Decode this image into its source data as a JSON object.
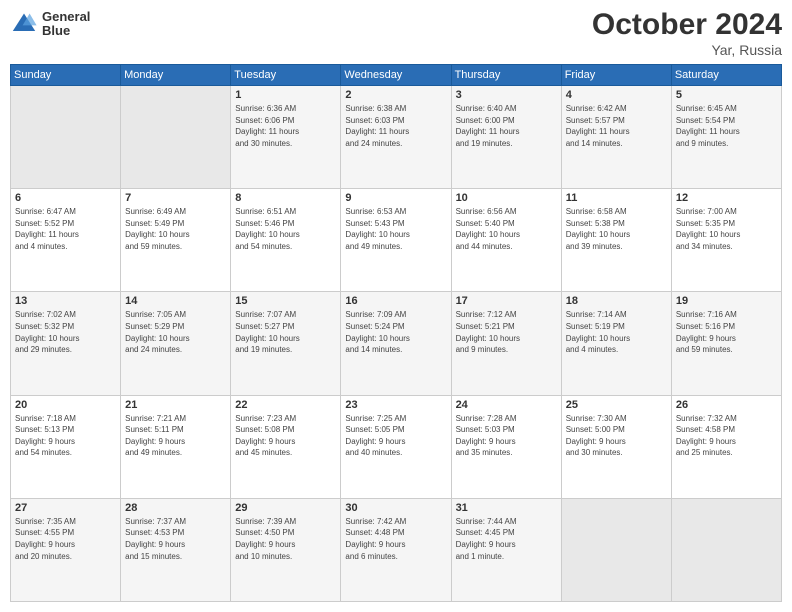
{
  "header": {
    "logo_line1": "General",
    "logo_line2": "Blue",
    "month": "October 2024",
    "location": "Yar, Russia"
  },
  "days_of_week": [
    "Sunday",
    "Monday",
    "Tuesday",
    "Wednesday",
    "Thursday",
    "Friday",
    "Saturday"
  ],
  "weeks": [
    [
      {
        "day": "",
        "info": ""
      },
      {
        "day": "",
        "info": ""
      },
      {
        "day": "1",
        "info": "Sunrise: 6:36 AM\nSunset: 6:06 PM\nDaylight: 11 hours\nand 30 minutes."
      },
      {
        "day": "2",
        "info": "Sunrise: 6:38 AM\nSunset: 6:03 PM\nDaylight: 11 hours\nand 24 minutes."
      },
      {
        "day": "3",
        "info": "Sunrise: 6:40 AM\nSunset: 6:00 PM\nDaylight: 11 hours\nand 19 minutes."
      },
      {
        "day": "4",
        "info": "Sunrise: 6:42 AM\nSunset: 5:57 PM\nDaylight: 11 hours\nand 14 minutes."
      },
      {
        "day": "5",
        "info": "Sunrise: 6:45 AM\nSunset: 5:54 PM\nDaylight: 11 hours\nand 9 minutes."
      }
    ],
    [
      {
        "day": "6",
        "info": "Sunrise: 6:47 AM\nSunset: 5:52 PM\nDaylight: 11 hours\nand 4 minutes."
      },
      {
        "day": "7",
        "info": "Sunrise: 6:49 AM\nSunset: 5:49 PM\nDaylight: 10 hours\nand 59 minutes."
      },
      {
        "day": "8",
        "info": "Sunrise: 6:51 AM\nSunset: 5:46 PM\nDaylight: 10 hours\nand 54 minutes."
      },
      {
        "day": "9",
        "info": "Sunrise: 6:53 AM\nSunset: 5:43 PM\nDaylight: 10 hours\nand 49 minutes."
      },
      {
        "day": "10",
        "info": "Sunrise: 6:56 AM\nSunset: 5:40 PM\nDaylight: 10 hours\nand 44 minutes."
      },
      {
        "day": "11",
        "info": "Sunrise: 6:58 AM\nSunset: 5:38 PM\nDaylight: 10 hours\nand 39 minutes."
      },
      {
        "day": "12",
        "info": "Sunrise: 7:00 AM\nSunset: 5:35 PM\nDaylight: 10 hours\nand 34 minutes."
      }
    ],
    [
      {
        "day": "13",
        "info": "Sunrise: 7:02 AM\nSunset: 5:32 PM\nDaylight: 10 hours\nand 29 minutes."
      },
      {
        "day": "14",
        "info": "Sunrise: 7:05 AM\nSunset: 5:29 PM\nDaylight: 10 hours\nand 24 minutes."
      },
      {
        "day": "15",
        "info": "Sunrise: 7:07 AM\nSunset: 5:27 PM\nDaylight: 10 hours\nand 19 minutes."
      },
      {
        "day": "16",
        "info": "Sunrise: 7:09 AM\nSunset: 5:24 PM\nDaylight: 10 hours\nand 14 minutes."
      },
      {
        "day": "17",
        "info": "Sunrise: 7:12 AM\nSunset: 5:21 PM\nDaylight: 10 hours\nand 9 minutes."
      },
      {
        "day": "18",
        "info": "Sunrise: 7:14 AM\nSunset: 5:19 PM\nDaylight: 10 hours\nand 4 minutes."
      },
      {
        "day": "19",
        "info": "Sunrise: 7:16 AM\nSunset: 5:16 PM\nDaylight: 9 hours\nand 59 minutes."
      }
    ],
    [
      {
        "day": "20",
        "info": "Sunrise: 7:18 AM\nSunset: 5:13 PM\nDaylight: 9 hours\nand 54 minutes."
      },
      {
        "day": "21",
        "info": "Sunrise: 7:21 AM\nSunset: 5:11 PM\nDaylight: 9 hours\nand 49 minutes."
      },
      {
        "day": "22",
        "info": "Sunrise: 7:23 AM\nSunset: 5:08 PM\nDaylight: 9 hours\nand 45 minutes."
      },
      {
        "day": "23",
        "info": "Sunrise: 7:25 AM\nSunset: 5:05 PM\nDaylight: 9 hours\nand 40 minutes."
      },
      {
        "day": "24",
        "info": "Sunrise: 7:28 AM\nSunset: 5:03 PM\nDaylight: 9 hours\nand 35 minutes."
      },
      {
        "day": "25",
        "info": "Sunrise: 7:30 AM\nSunset: 5:00 PM\nDaylight: 9 hours\nand 30 minutes."
      },
      {
        "day": "26",
        "info": "Sunrise: 7:32 AM\nSunset: 4:58 PM\nDaylight: 9 hours\nand 25 minutes."
      }
    ],
    [
      {
        "day": "27",
        "info": "Sunrise: 7:35 AM\nSunset: 4:55 PM\nDaylight: 9 hours\nand 20 minutes."
      },
      {
        "day": "28",
        "info": "Sunrise: 7:37 AM\nSunset: 4:53 PM\nDaylight: 9 hours\nand 15 minutes."
      },
      {
        "day": "29",
        "info": "Sunrise: 7:39 AM\nSunset: 4:50 PM\nDaylight: 9 hours\nand 10 minutes."
      },
      {
        "day": "30",
        "info": "Sunrise: 7:42 AM\nSunset: 4:48 PM\nDaylight: 9 hours\nand 6 minutes."
      },
      {
        "day": "31",
        "info": "Sunrise: 7:44 AM\nSunset: 4:45 PM\nDaylight: 9 hours\nand 1 minute."
      },
      {
        "day": "",
        "info": ""
      },
      {
        "day": "",
        "info": ""
      }
    ]
  ]
}
